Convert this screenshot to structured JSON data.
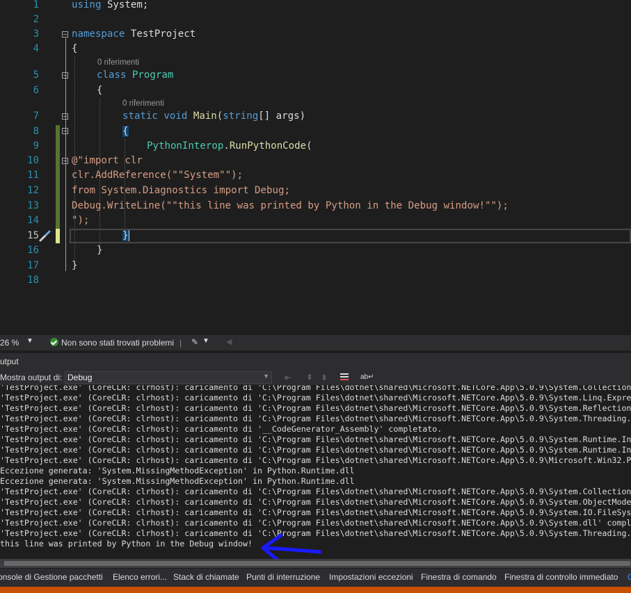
{
  "editor": {
    "line_numbers": [
      "1",
      "2",
      "3",
      "4",
      "5",
      "6",
      "7",
      "8",
      "9",
      "10",
      "11",
      "12",
      "13",
      "14",
      "15",
      "16",
      "17",
      "18"
    ],
    "code_lens_1": "0 riferimenti",
    "code_lens_2": "0 riferimenti",
    "tokens": {
      "using": "using",
      "system": "System;",
      "namespace": "namespace",
      "test_project": "TestProject",
      "open_brace": "{",
      "class_kw": "class",
      "program": "Program",
      "static_void": "static void",
      "main": "Main",
      "paren_open": "(",
      "string_kw": "string",
      "args_rest": "[] args)",
      "python_interop": "PythonInterop",
      "dot": ".",
      "run_python_code": "RunPythonCode",
      "paren": "(",
      "line10": "@\"import clr",
      "line11": "clr.AddReference(\"\"System\"\");",
      "line12": "from System.Diagnostics import Debug;",
      "line13": "Debug.WriteLine(\"\"this line was printed by Python in the Debug window!\"\");",
      "line14": "\");",
      "close_brace": "}"
    }
  },
  "status": {
    "zoom": "26 %",
    "issues": "Non sono stati trovati problemi"
  },
  "output": {
    "title": "utput",
    "show_output_label": "Mostra output di:",
    "source": "Debug",
    "lines": [
      "'TestProject.exe' (CoreCLR: clrhost): caricamento di 'C:\\Program Files\\dotnet\\shared\\Microsoft.NETCore.App\\5.0.9\\System.Collection",
      "'TestProject.exe' (CoreCLR: clrhost): caricamento di 'C:\\Program Files\\dotnet\\shared\\Microsoft.NETCore.App\\5.0.9\\System.Linq.Expre",
      "'TestProject.exe' (CoreCLR: clrhost): caricamento di 'C:\\Program Files\\dotnet\\shared\\Microsoft.NETCore.App\\5.0.9\\System.Reflection",
      "'TestProject.exe' (CoreCLR: clrhost): caricamento di 'C:\\Program Files\\dotnet\\shared\\Microsoft.NETCore.App\\5.0.9\\System.Threading.",
      "'TestProject.exe' (CoreCLR: clrhost): caricamento di '__CodeGenerator_Assembly' completato.",
      "'TestProject.exe' (CoreCLR: clrhost): caricamento di 'C:\\Program Files\\dotnet\\shared\\Microsoft.NETCore.App\\5.0.9\\System.Runtime.In",
      "'TestProject.exe' (CoreCLR: clrhost): caricamento di 'C:\\Program Files\\dotnet\\shared\\Microsoft.NETCore.App\\5.0.9\\System.Runtime.In",
      "'TestProject.exe' (CoreCLR: clrhost): caricamento di 'C:\\Program Files\\dotnet\\shared\\Microsoft.NETCore.App\\5.0.9\\Microsoft.Win32.P",
      "Eccezione generata: 'System.MissingMethodException' in Python.Runtime.dll",
      "Eccezione generata: 'System.MissingMethodException' in Python.Runtime.dll",
      "'TestProject.exe' (CoreCLR: clrhost): caricamento di 'C:\\Program Files\\dotnet\\shared\\Microsoft.NETCore.App\\5.0.9\\System.Collection",
      "'TestProject.exe' (CoreCLR: clrhost): caricamento di 'C:\\Program Files\\dotnet\\shared\\Microsoft.NETCore.App\\5.0.9\\System.ObjectMode",
      "'TestProject.exe' (CoreCLR: clrhost): caricamento di 'C:\\Program Files\\dotnet\\shared\\Microsoft.NETCore.App\\5.0.9\\System.IO.FileSys",
      "'TestProject.exe' (CoreCLR: clrhost): caricamento di 'C:\\Program Files\\dotnet\\shared\\Microsoft.NETCore.App\\5.0.9\\System.dll' compl",
      "'TestProject.exe' (CoreCLR: clrhost): caricamento di 'C:\\Program Files\\dotnet\\shared\\Microsoft.NETCore.App\\5.0.9\\System.Threading.",
      "this line was printed by Python in the Debug window!"
    ]
  },
  "bottom_tabs": {
    "t0": "onsole di Gestione pacchetti",
    "t1": "Elenco errori...",
    "t2": "Stack di chiamate",
    "t3": "Punti di interruzione",
    "t4": "Impostazioni eccezioni",
    "t5": "Finestra di comando",
    "t6": "Finestra di controllo immediato",
    "t7": "O"
  },
  "colors": {
    "accent_orange": "#ca5100",
    "annotation_arrow": "#1a1aff"
  }
}
